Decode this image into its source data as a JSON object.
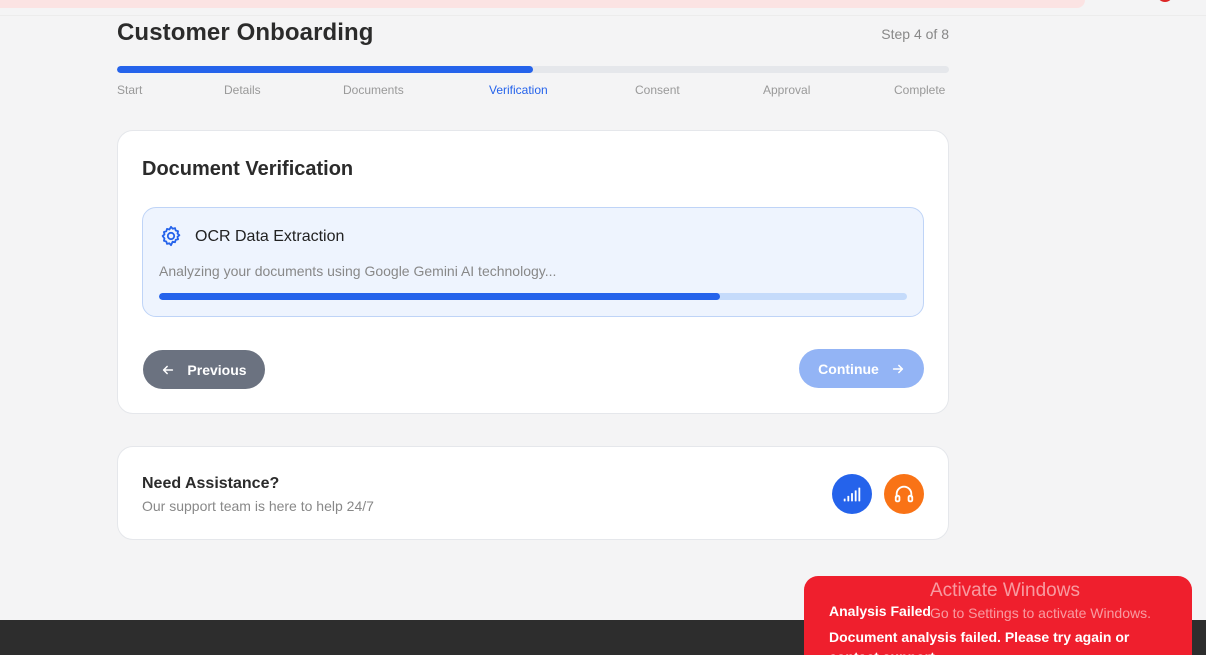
{
  "header": {
    "title": "Customer Onboarding",
    "step_counter": "Step 4 of 8",
    "progress_fraction": 0.5
  },
  "steps": [
    {
      "label": "Start",
      "active": false
    },
    {
      "label": "Details",
      "active": false
    },
    {
      "label": "Documents",
      "active": false
    },
    {
      "label": "Verification",
      "active": true
    },
    {
      "label": "Consent",
      "active": false
    },
    {
      "label": "Approval",
      "active": false
    },
    {
      "label": "Complete",
      "active": false
    }
  ],
  "verification": {
    "title": "Document Verification",
    "ocr": {
      "icon": "gear-icon",
      "title": "OCR Data Extraction",
      "description": "Analyzing your documents using Google Gemini AI technology...",
      "progress_fraction": 0.75
    },
    "previous_label": "Previous",
    "continue_label": "Continue"
  },
  "assistance": {
    "title": "Need Assistance?",
    "subtitle": "Our support team is here to help 24/7",
    "buttons": [
      {
        "icon": "signal-bars-icon",
        "color": "#2563eb"
      },
      {
        "icon": "headset-icon",
        "color": "#f97316"
      }
    ]
  },
  "toast": {
    "title": "Analysis Failed",
    "message": "Document analysis failed. Please try again or contact support.",
    "color": "#ef1f2d"
  },
  "watermark": {
    "line1": "Activate Windows",
    "line2": "Go to Settings to activate Windows."
  },
  "colors": {
    "accent": "#2563eb",
    "secondary_button": "#6b7280",
    "disabled_button": "#93b4f5"
  }
}
